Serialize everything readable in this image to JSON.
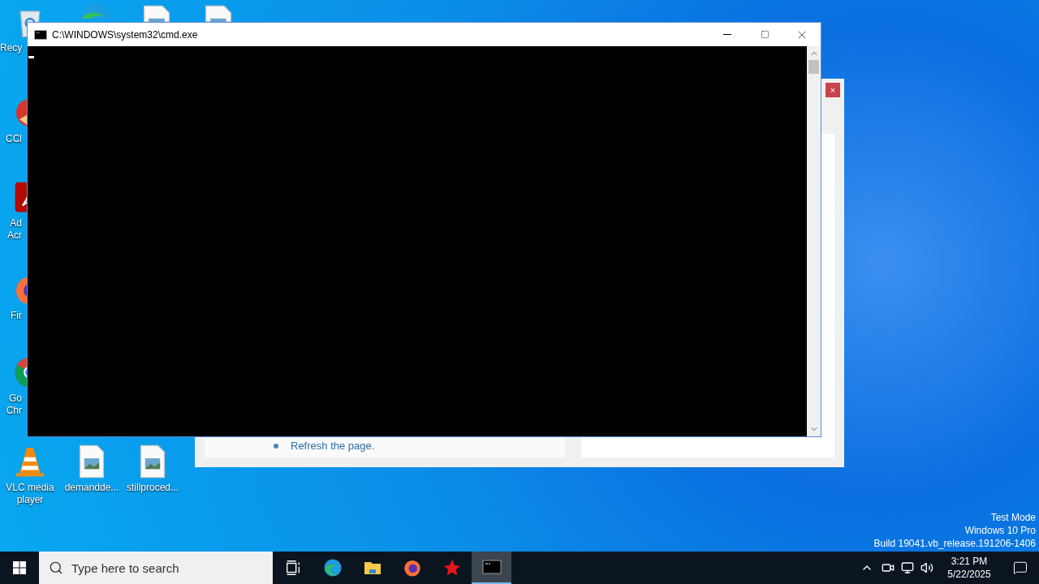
{
  "desktop_icons": [
    {
      "kind": "recycle",
      "label_lines": [
        "Recy"
      ]
    },
    {
      "kind": "edge"
    },
    {
      "kind": "image"
    },
    {
      "kind": "image"
    },
    {
      "kind": "ccleaner",
      "label_lines": [
        "CCl"
      ]
    },
    {
      "kind": "acrobat",
      "label_lines": [
        "Ad",
        "Acr"
      ]
    },
    {
      "kind": "firefox",
      "label_lines": [
        "Fir"
      ]
    },
    {
      "kind": "chrome",
      "label_lines": [
        "Go",
        "Chr"
      ]
    },
    {
      "kind": "vlc",
      "label_lines": [
        "VLC media",
        "player"
      ]
    },
    {
      "kind": "image",
      "label_lines": [
        "demandde..."
      ]
    },
    {
      "kind": "image",
      "label_lines": [
        "stillproced..."
      ]
    }
  ],
  "background_window": {
    "close": "×",
    "link": "Refresh the page."
  },
  "cmd_window": {
    "title": "C:\\WINDOWS\\system32\\cmd.exe"
  },
  "watermark_text": [
    "Test Mode",
    "Windows 10 Pro",
    "Build 19041.vb_release.191206-1406"
  ],
  "taskbar": {
    "search_placeholder": "Type here to search",
    "apps": [
      {
        "kind": "taskview",
        "selected": false
      },
      {
        "kind": "edge",
        "selected": false
      },
      {
        "kind": "explorer",
        "selected": false
      },
      {
        "kind": "firefox",
        "selected": false
      },
      {
        "kind": "star",
        "selected": false
      },
      {
        "kind": "cmd",
        "selected": true
      }
    ],
    "time": "3:21 PM",
    "date": "5/22/2025"
  }
}
